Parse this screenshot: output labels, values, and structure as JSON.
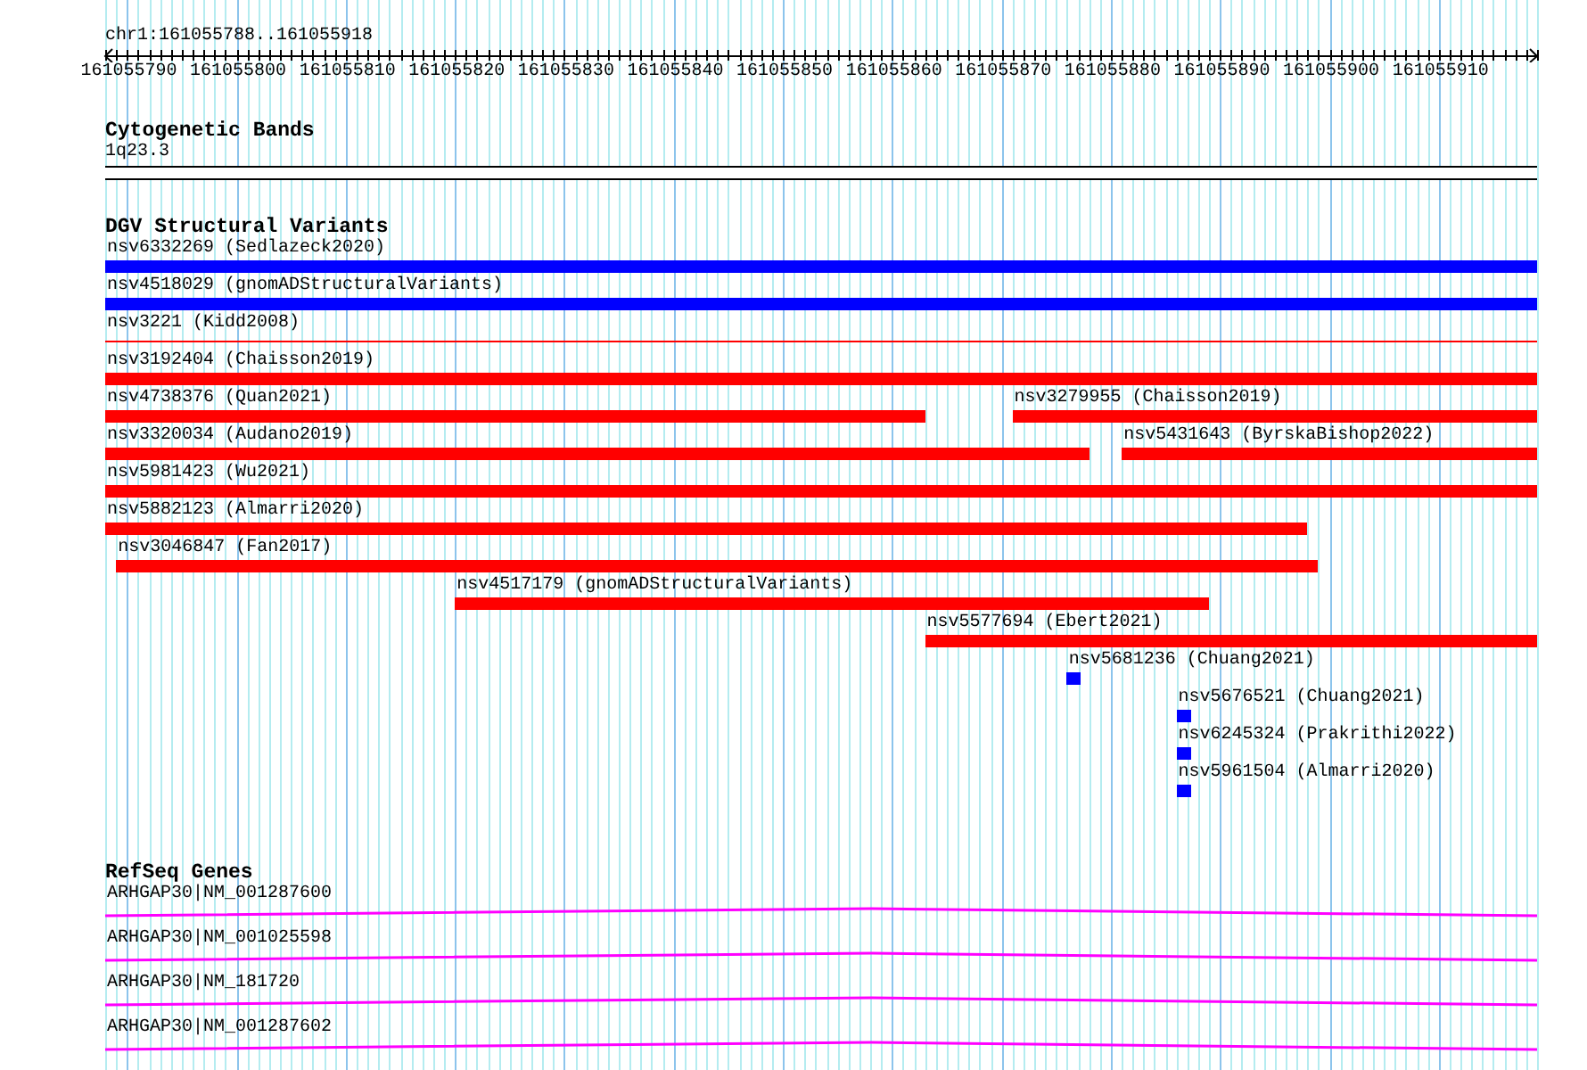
{
  "ruler": {
    "title": "chr1:161055788..161055918",
    "ticks": [
      "161055790",
      "161055800",
      "161055810",
      "161055820",
      "161055830",
      "161055840",
      "161055850",
      "161055860",
      "161055870",
      "161055880",
      "161055890",
      "161055900",
      "161055910"
    ]
  },
  "cytogenetic_bands": {
    "title": "Cytogenetic Bands",
    "band": "1q23.3"
  },
  "dgv": {
    "title": "DGV Structural Variants",
    "rows": [
      {
        "variants": [
          {
            "label": "nsv6332269 (Sedlazeck2020)",
            "color": "#0000ff",
            "kind": "thick"
          }
        ]
      },
      {
        "variants": [
          {
            "label": "nsv4518029 (gnomADStructuralVariants)",
            "color": "#0000ff",
            "kind": "thick"
          }
        ]
      },
      {
        "variants": [
          {
            "label": "nsv3221 (Kidd2008)",
            "color": "#ff0000",
            "kind": "thin"
          }
        ]
      },
      {
        "variants": [
          {
            "label": "nsv3192404 (Chaisson2019)",
            "color": "#ff0000",
            "kind": "thick"
          }
        ]
      },
      {
        "variants": [
          {
            "label": "nsv4738376 (Quan2021)",
            "color": "#ff0000",
            "kind": "thick"
          },
          {
            "label": "nsv3279955 (Chaisson2019)",
            "color": "#ff0000",
            "kind": "thick"
          }
        ]
      },
      {
        "variants": [
          {
            "label": "nsv3320034 (Audano2019)",
            "color": "#ff0000",
            "kind": "thick"
          },
          {
            "label": "nsv5431643 (ByrskaBishop2022)",
            "color": "#ff0000",
            "kind": "thick"
          }
        ]
      },
      {
        "variants": [
          {
            "label": "nsv5981423 (Wu2021)",
            "color": "#ff0000",
            "kind": "thick"
          }
        ]
      },
      {
        "variants": [
          {
            "label": "nsv5882123 (Almarri2020)",
            "color": "#ff0000",
            "kind": "thick"
          }
        ]
      },
      {
        "variants": [
          {
            "label": "nsv3046847 (Fan2017)",
            "color": "#ff0000",
            "kind": "thick"
          }
        ]
      },
      {
        "variants": [
          {
            "label": "nsv4517179 (gnomADStructuralVariants)",
            "color": "#ff0000",
            "kind": "thick"
          }
        ]
      },
      {
        "variants": [
          {
            "label": "nsv5577694 (Ebert2021)",
            "color": "#ff0000",
            "kind": "thick"
          }
        ]
      },
      {
        "variants": [
          {
            "label": "nsv5681236 (Chuang2021)",
            "color": "#0000ff",
            "kind": "thick"
          }
        ]
      },
      {
        "variants": [
          {
            "label": "nsv5676521 (Chuang2021)",
            "color": "#0000ff",
            "kind": "thick"
          }
        ]
      },
      {
        "variants": [
          {
            "label": "nsv6245324 (Prakrithi2022)",
            "color": "#0000ff",
            "kind": "thick"
          }
        ]
      },
      {
        "variants": [
          {
            "label": "nsv5961504 (Almarri2020)",
            "color": "#0000ff",
            "kind": "thick"
          }
        ]
      }
    ]
  },
  "refseq_genes": {
    "title": "RefSeq Genes",
    "transcripts": [
      {
        "label": "ARHGAP30|NM_001287600"
      },
      {
        "label": "ARHGAP30|NM_001025598"
      },
      {
        "label": "ARHGAP30|NM_181720"
      },
      {
        "label": "ARHGAP30|NM_001287602"
      }
    ]
  }
}
